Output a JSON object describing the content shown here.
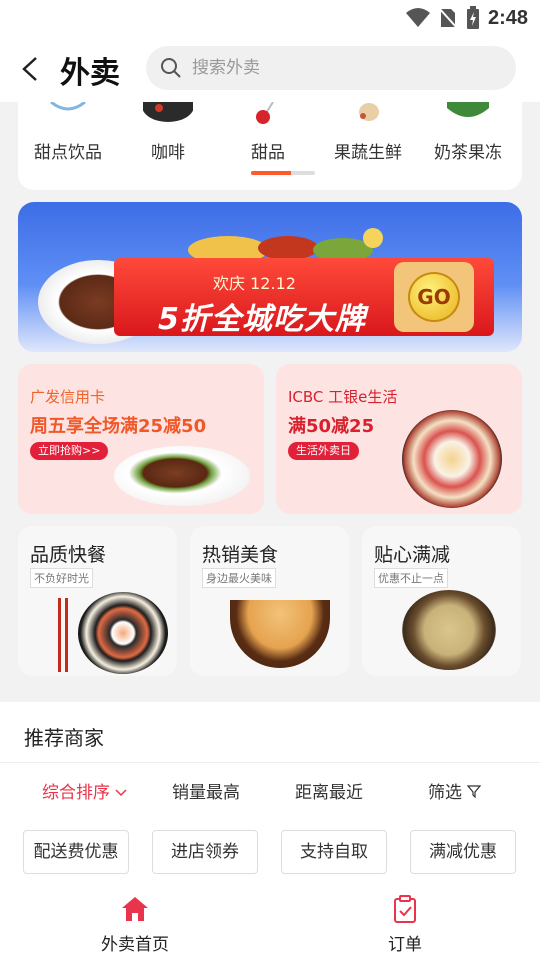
{
  "status_bar": {
    "time": "2:48"
  },
  "header": {
    "title": "外卖",
    "search_placeholder": "搜索外卖"
  },
  "categories": {
    "items": [
      {
        "label": "甜点饮品"
      },
      {
        "label": "咖啡"
      },
      {
        "label": "甜品"
      },
      {
        "label": "果蔬生鲜"
      },
      {
        "label": "奶茶果冻"
      }
    ],
    "scroll_fraction": 0.62
  },
  "banner": {
    "subtitle": "欢庆 12.12",
    "title": "5折全城吃大牌",
    "go": "GO"
  },
  "promos": [
    {
      "kicker": "广发信用卡",
      "headline": "周五享全场满25减50",
      "tag": "立即抢购>>"
    },
    {
      "kicker": "ICBC 工银e生活",
      "headline": "满50减25",
      "tag": "生活外卖日"
    }
  ],
  "features": [
    {
      "title": "品质快餐",
      "subtitle": "不负好时光"
    },
    {
      "title": "热销美食",
      "subtitle": "身边最火美味"
    },
    {
      "title": "贴心满减",
      "subtitle": "优惠不止一点"
    }
  ],
  "recommend": {
    "title": "推荐商家",
    "sort": {
      "comprehensive": "综合排序",
      "sales": "销量最高",
      "distance": "距离最近",
      "filter": "筛选"
    },
    "chips": [
      "配送费优惠",
      "进店领券",
      "支持自取",
      "满减优惠"
    ]
  },
  "bottom_nav": [
    {
      "label": "外卖首页"
    },
    {
      "label": "订单"
    }
  ],
  "colors": {
    "accent": "#e8354b",
    "orange": "#ff5a2c"
  }
}
